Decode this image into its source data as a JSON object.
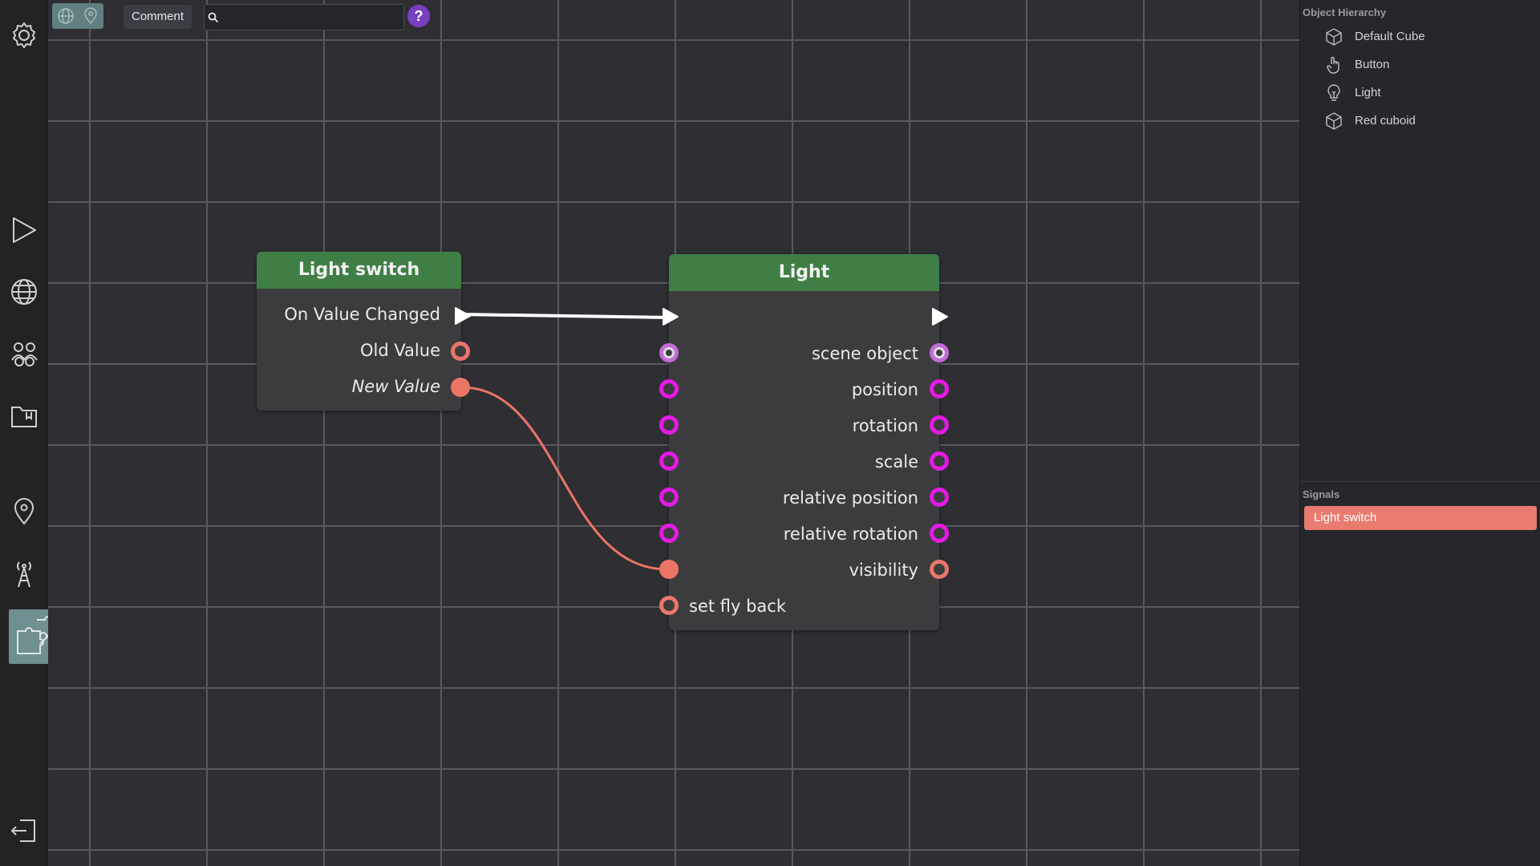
{
  "toolbar": {
    "comment_label": "Comment",
    "search_placeholder": "",
    "help_label": "?"
  },
  "left_sidebar": {
    "icons": [
      "settings-icon",
      "play-icon",
      "globe-icon",
      "people-icon",
      "folder-icon",
      "location-pin-icon",
      "antenna-icon",
      "blocks-icon",
      "exit-icon"
    ]
  },
  "nodes": {
    "light_switch": {
      "title": "Light switch",
      "outputs": [
        "On Value Changed",
        "Old Value",
        "New Value"
      ]
    },
    "light": {
      "title": "Light",
      "ports": [
        "scene object",
        "position",
        "rotation",
        "scale",
        "relative position",
        "relative rotation",
        "visibility",
        "set fly back"
      ]
    }
  },
  "object_hierarchy": {
    "title": "Object Hierarchy",
    "items": [
      {
        "label": "Default Cube",
        "icon": "cube-icon"
      },
      {
        "label": "Button",
        "icon": "hand-pointer-icon"
      },
      {
        "label": "Light",
        "icon": "lightbulb-icon"
      },
      {
        "label": "Red cuboid",
        "icon": "cube-icon"
      }
    ]
  },
  "signals": {
    "title": "Signals",
    "items": [
      "Light switch"
    ]
  },
  "colors": {
    "node_header": "#3f7f45",
    "port_pink": "#e619e6",
    "port_salmon": "#ec7566",
    "signal_selected": "#ea7b70",
    "accent_help": "#7a3ec2"
  }
}
